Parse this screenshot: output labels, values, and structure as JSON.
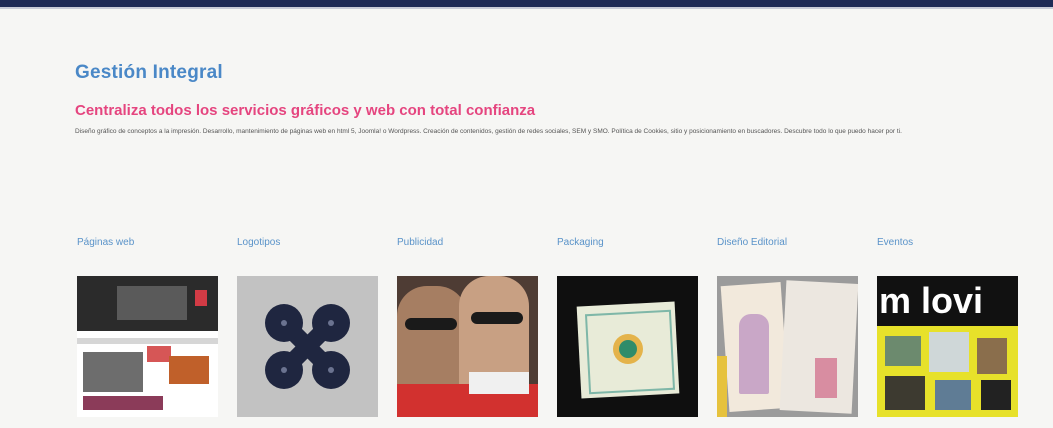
{
  "header": {
    "title": "Gestión Integral",
    "subtitle": "Centraliza todos los servicios gráficos y web con total confianza",
    "description": "Diseño gráfico de conceptos a la impresión. Desarrollo, mantenimiento de páginas web en html 5, Joomla! o Wordpress. Creación de contenidos, gestión de redes sociales, SEM y SMO. Política de Cookies, sitio y posicionamiento en buscadores. Descubre todo lo que puedo hacer por ti."
  },
  "categories": [
    {
      "label": "Páginas web",
      "thumb_icon": "web-page-screenshot"
    },
    {
      "label": "Logotipos",
      "thumb_icon": "logo-clover-mark"
    },
    {
      "label": "Publicidad",
      "thumb_icon": "advertising-photo"
    },
    {
      "label": "Packaging",
      "thumb_icon": "package-box"
    },
    {
      "label": "Diseño Editorial",
      "thumb_icon": "magazine-spread"
    },
    {
      "label": "Eventos",
      "thumb_icon": "event-poster"
    }
  ],
  "thumb_texts": {
    "eventos_poster": "m lovi"
  },
  "colors": {
    "title": "#4a88c7",
    "subtitle": "#e5457f",
    "category_link": "#5a93c9",
    "top_bar": "#1f2b56",
    "background": "#f6f6f4"
  }
}
